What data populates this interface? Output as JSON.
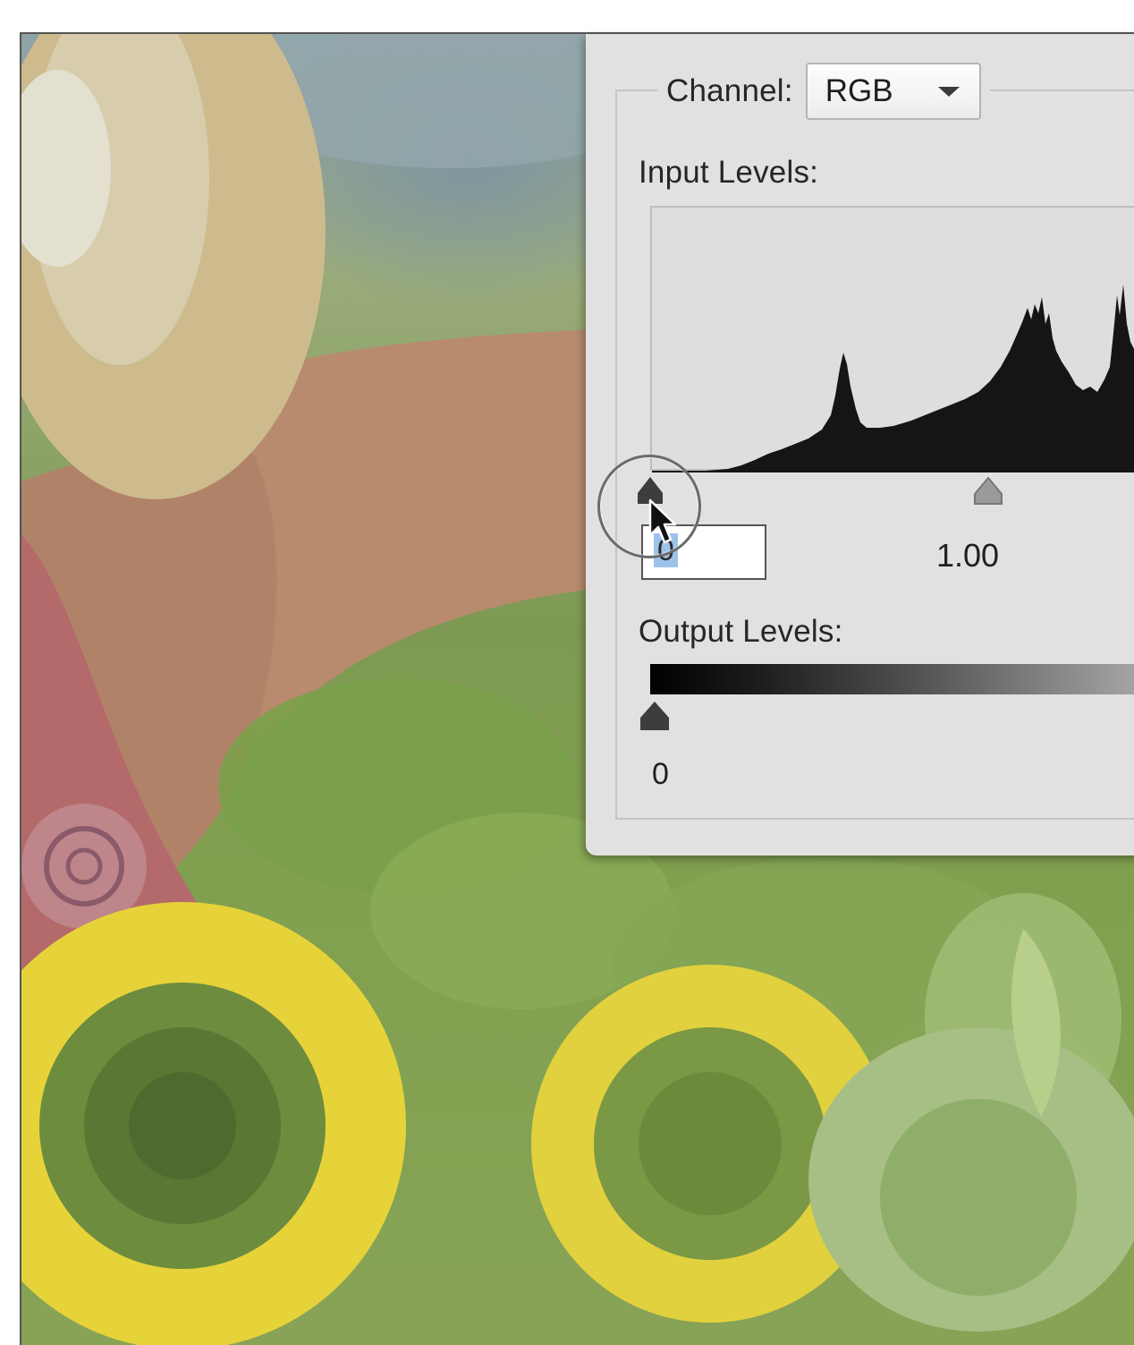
{
  "dialog": {
    "channel_label": "Channel:",
    "channel_value": "RGB",
    "input_levels_label": "Input Levels:",
    "input_black_value": "0",
    "input_gamma_value": "1.00",
    "output_levels_label": "Output Levels:",
    "output_black_value": "0"
  },
  "icons": {
    "channel_dropdown": "chevron-down-icon",
    "input_black_slider": "slider-handle-black-icon",
    "input_gamma_slider": "slider-handle-gray-icon",
    "output_black_slider": "slider-handle-black-icon",
    "cursor": "mouse-pointer-icon"
  },
  "colors": {
    "dialog_bg": "#e1e1e1",
    "histogram_fill": "#151515",
    "selection_highlight": "#9ec3ea"
  }
}
